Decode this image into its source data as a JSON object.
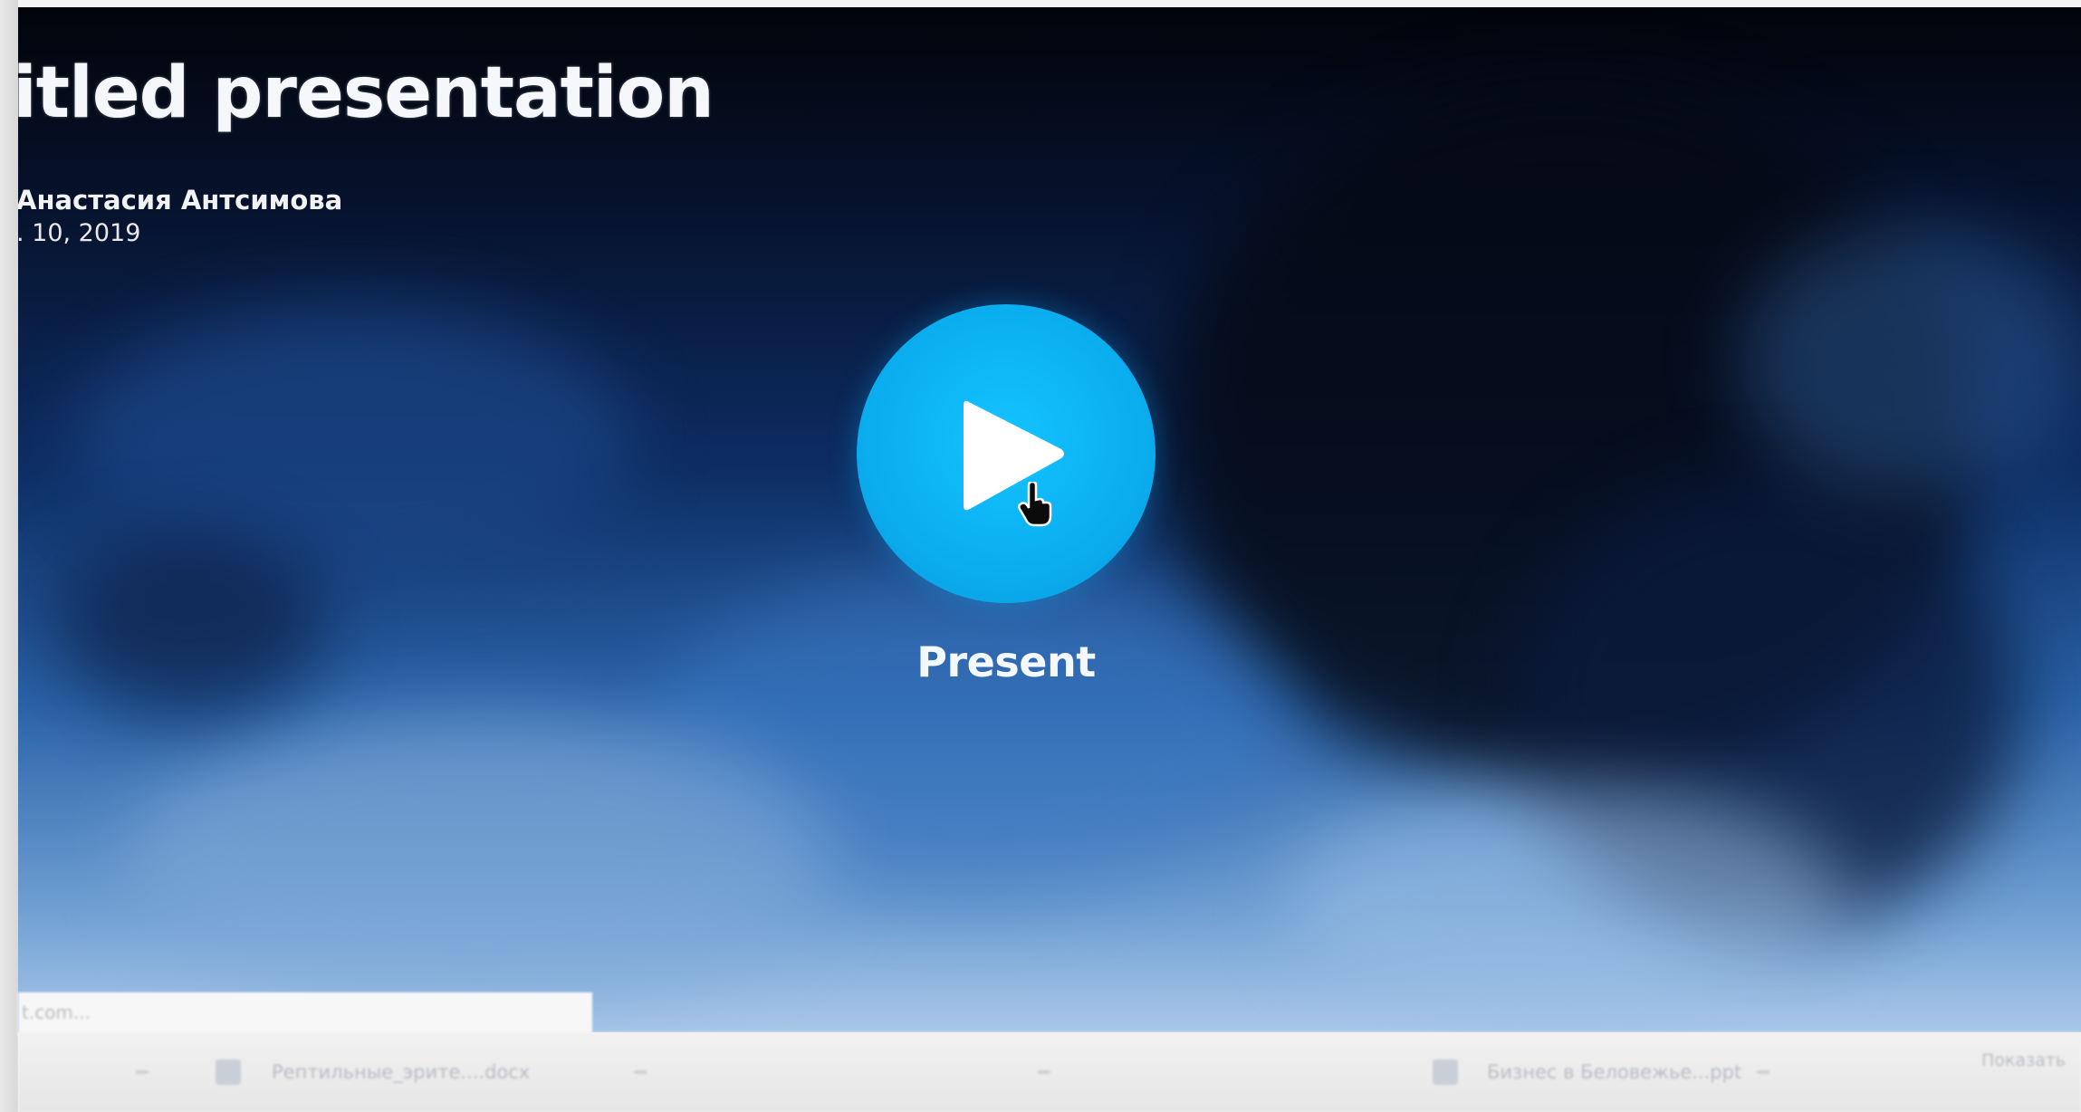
{
  "slide": {
    "title": "itled presentation",
    "author": "Анастасия Антсимова",
    "date": ". 10, 2019"
  },
  "present": {
    "label": "Present",
    "accent_color": "#0aaeef"
  },
  "download_bar": {
    "tab_label": "t.com..."
  },
  "taskbar": {
    "items": [
      {
        "label": "Рептильные_эрите....docx",
        "icon": "document-icon"
      },
      {
        "label": "Бизнес в Беловежье...ppt",
        "icon": "presentation-icon"
      }
    ],
    "show_all_label": "Показать"
  },
  "icons": {
    "play": "play-icon",
    "cursor": "hand-cursor-icon"
  }
}
